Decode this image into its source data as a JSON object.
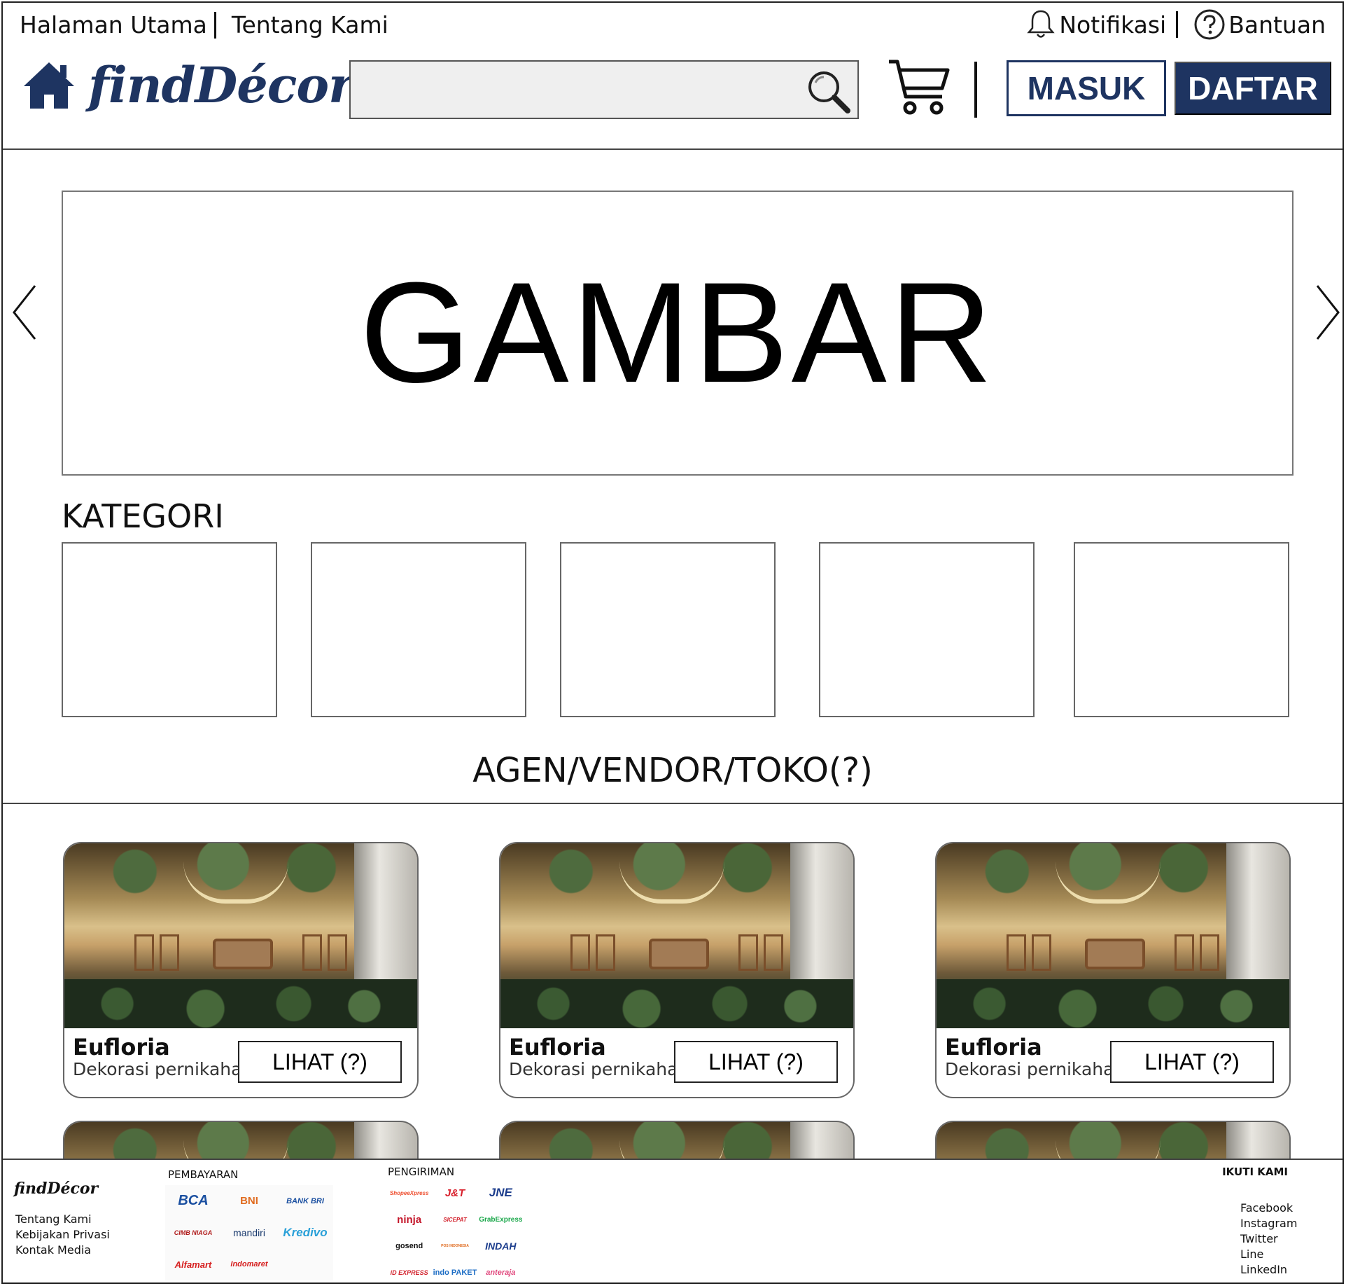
{
  "topnav": {
    "home": "Halaman Utama",
    "about": "Tentang Kami",
    "notifications": "Notifikasi",
    "help": "Bantuan"
  },
  "brand": {
    "name": "findDécor",
    "color": "#1e3461"
  },
  "search": {
    "placeholder": ""
  },
  "buttons": {
    "login": "MASUK",
    "register": "DAFTAR"
  },
  "hero": {
    "text": "GAMBAR"
  },
  "categories": {
    "title": "KATEGORI"
  },
  "vendors": {
    "title": "AGEN/VENDOR/TOKO(?)",
    "cards": [
      {
        "name": "Eufloria",
        "subtitle": "Dekorasi pernikahan",
        "button": "LIHAT (?)"
      },
      {
        "name": "Eufloria",
        "subtitle": "Dekorasi pernikahan",
        "button": "LIHAT (?)"
      },
      {
        "name": "Eufloria",
        "subtitle": "Dekorasi pernikahan",
        "button": "LIHAT (?)"
      }
    ]
  },
  "footer": {
    "logo": "findDécor",
    "links": [
      "Tentang Kami",
      "Kebijakan Privasi",
      "Kontak Media"
    ],
    "payment_title": "PEMBAYARAN",
    "payments": [
      "BCA",
      "BNI",
      "BANK BRI",
      "CIMB NIAGA",
      "mandiri",
      "Kredivo",
      "Alfamart",
      "Indomaret"
    ],
    "shipping_title": "PENGIRIMAN",
    "shipping": [
      "ShopeeXpress",
      "J&T",
      "JNE",
      "ninja",
      "SICEPAT",
      "GrabExpress",
      "gosend",
      "POS INDONESIA",
      "INDAH",
      "iD EXPRESS",
      "indo PAKET",
      "anteraja"
    ],
    "follow_title": "IKUTI KAMI",
    "social": [
      "Facebook",
      "Instagram",
      "Twitter",
      "Line",
      "LinkedIn"
    ]
  }
}
